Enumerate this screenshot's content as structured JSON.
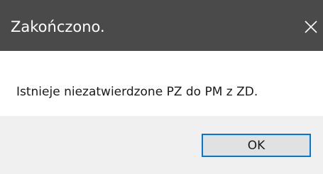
{
  "window": {
    "title": "Zakończono.",
    "close_icon": "close-icon"
  },
  "message": {
    "text": "Istnieje niezatwierdzone PZ do PM z ZD."
  },
  "buttons": {
    "ok_label": "OK"
  },
  "colors": {
    "titlebar": "#4a4a4a",
    "footer": "#f0f0f0",
    "button_border": "#0078d7",
    "button_bg": "#e1e1e1"
  }
}
